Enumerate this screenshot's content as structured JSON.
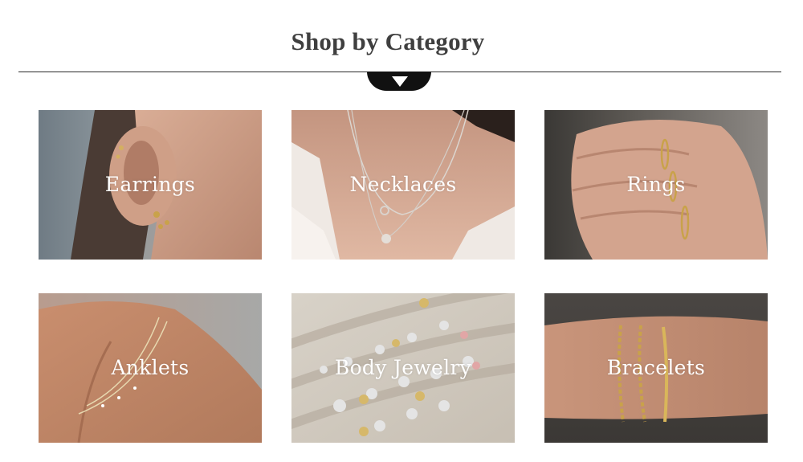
{
  "section": {
    "title": "Shop by Category"
  },
  "categories": [
    {
      "label": "Earrings"
    },
    {
      "label": "Necklaces"
    },
    {
      "label": "Rings"
    },
    {
      "label": "Anklets"
    },
    {
      "label": "Body Jewelry"
    },
    {
      "label": "Bracelets"
    }
  ],
  "colors": {
    "title": "#3f3f3f",
    "divider": "#2b2b2b",
    "badge": "#111111",
    "label_text": "#ffffff"
  },
  "icons": {
    "divider_badge": "chevron-down-icon"
  }
}
